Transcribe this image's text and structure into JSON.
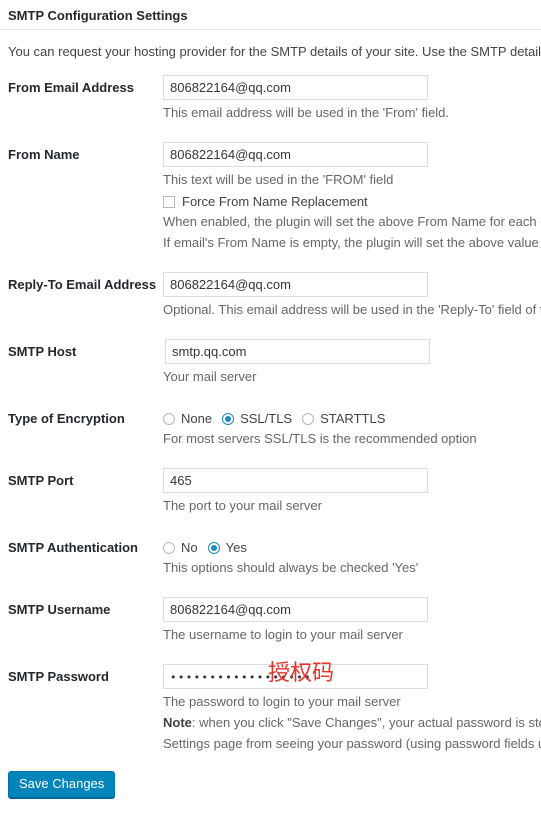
{
  "panel": {
    "title": "SMTP Configuration Settings",
    "intro": "You can request your hosting provider for the SMTP details of your site. Use the SMTP details provide"
  },
  "fields": {
    "from_email": {
      "label": "From Email Address",
      "value": "806822164@qq.com",
      "hint": "This email address will be used in the 'From' field."
    },
    "from_name": {
      "label": "From Name",
      "value": "806822164@qq.com",
      "hint": "This text will be used in the 'FROM' field",
      "checkbox_label": "Force From Name Replacement",
      "checkbox_checked": false,
      "hint2": "When enabled, the plugin will set the above From Name for each ema",
      "hint3": "If email's From Name is empty, the plugin will set the above value rega"
    },
    "reply_to": {
      "label": "Reply-To Email Address",
      "value": "806822164@qq.com",
      "hint": "Optional. This email address will be used in the 'Reply-To' field of the"
    },
    "smtp_host": {
      "label": "SMTP Host",
      "value": "smtp.qq.com",
      "hint": "Your mail server"
    },
    "encryption": {
      "label": "Type of Encryption",
      "options": [
        "None",
        "SSL/TLS",
        "STARTTLS"
      ],
      "selected": "SSL/TLS",
      "hint": "For most servers SSL/TLS is the recommended option"
    },
    "smtp_port": {
      "label": "SMTP Port",
      "value": "465",
      "hint": "The port to your mail server"
    },
    "authentication": {
      "label": "SMTP Authentication",
      "options": [
        "No",
        "Yes"
      ],
      "selected": "Yes",
      "hint": "This options should always be checked 'Yes'"
    },
    "smtp_username": {
      "label": "SMTP Username",
      "value": "806822164@qq.com",
      "hint": "The username to login to your mail server"
    },
    "smtp_password": {
      "label": "SMTP Password",
      "masked_value": "••••••••••••••••••",
      "annotation": "授权码",
      "annotation_color": "#e8322a",
      "hint": "The password to login to your mail server",
      "note_bold": "Note",
      "note_rest": ": when you click \"Save Changes\", your actual password is stored i",
      "note_line2": "Settings page from seeing your password (using password fields unma"
    }
  },
  "submit": {
    "label": "Save Changes"
  }
}
